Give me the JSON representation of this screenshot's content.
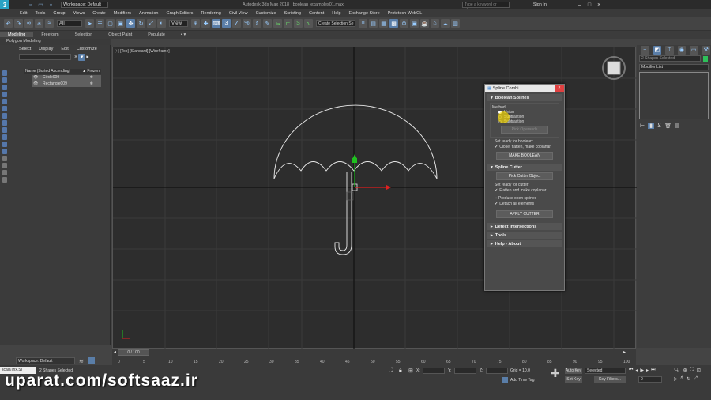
{
  "titlebar": {
    "workspace": "Workspace: Default",
    "app_title": "Autodesk 3ds Max 2018",
    "file_name": "boolean_examples01.max",
    "search_placeholder": "Type a keyword or phrase",
    "sign_in": "Sign In"
  },
  "menu": [
    "Edit",
    "Tools",
    "Group",
    "Views",
    "Create",
    "Modifiers",
    "Animation",
    "Graph Editors",
    "Rendering",
    "Civil View",
    "Customize",
    "Scripting",
    "Content",
    "Help",
    "Exchange Store",
    "Protetech WebGL"
  ],
  "toolbar": {
    "filter": "All",
    "view": "View",
    "selection_set": "Create Selection Se"
  },
  "ribbon": {
    "tabs": [
      "Modeling",
      "Freeform",
      "Selection",
      "Object Paint",
      "Populate"
    ],
    "sub": "Polygon Modeling"
  },
  "scene_explorer": {
    "menu": [
      "Select",
      "Display",
      "Edit",
      "Customize"
    ],
    "col_name": "Name (Sorted Ascending)",
    "col_frozen": "▲ Frozen",
    "items": [
      "Circle009",
      "Rectangle009"
    ]
  },
  "viewport": {
    "label": "[+] [Top] [Standard] [Wireframe]"
  },
  "dialog": {
    "title": "Spline Combi...",
    "close": "×",
    "boolean": {
      "header": "Boolean Splines",
      "method_label": "Method",
      "methods": [
        "Union",
        "Subtraction",
        "Subtraction"
      ],
      "pick_operands": "Pick Operands",
      "ready_label": "Set ready for boolean:",
      "close_check": "Close, flatten, make coplanar",
      "make_btn": "MAKE BOOLEAN"
    },
    "cutter": {
      "header": "Spline Cutter",
      "pick_btn": "Pick Cutter Object",
      "ready_label": "Set ready for cutter:",
      "flatten_check": "Flatten and make coplanar",
      "open_check": "Produce open splines",
      "detach_check": "Detach all elements",
      "apply_btn": "APPLY CUTTER"
    },
    "collapsed": [
      "Detect Intersections",
      "Tools",
      "Help - About"
    ]
  },
  "cmd_panel": {
    "selection": "2 Shapes Selected",
    "modifier_list": "Modifier List"
  },
  "timeline": {
    "frame": "0 / 100",
    "ticks": [
      "0",
      "5",
      "10",
      "15",
      "20",
      "25",
      "30",
      "35",
      "40",
      "45",
      "50",
      "55",
      "60",
      "65",
      "70",
      "75",
      "80",
      "85",
      "90",
      "95",
      "100"
    ]
  },
  "status": {
    "workspace": "Workspace: Default",
    "selected": "2 Shapes Selected",
    "script_box": "scalaTrix.SI",
    "x_label": "X:",
    "y_label": "Y:",
    "z_label": "Z:",
    "grid": "Grid = 10,0",
    "add_time_tag": "Add Time Tag",
    "auto_key": "Auto Key",
    "selected_dd": "Selected",
    "set_key": "Set Key",
    "key_filters": "Key Filters...",
    "frame_field": "0"
  },
  "watermark": "uparat.com/softsaaz.ir",
  "colors": {
    "viewport_bg": "#2d2d2d",
    "accent_blue": "#5a7ea8",
    "cursor_yellow": "#ffe000",
    "gizmo_red": "#e02020",
    "gizmo_green": "#20c020"
  }
}
